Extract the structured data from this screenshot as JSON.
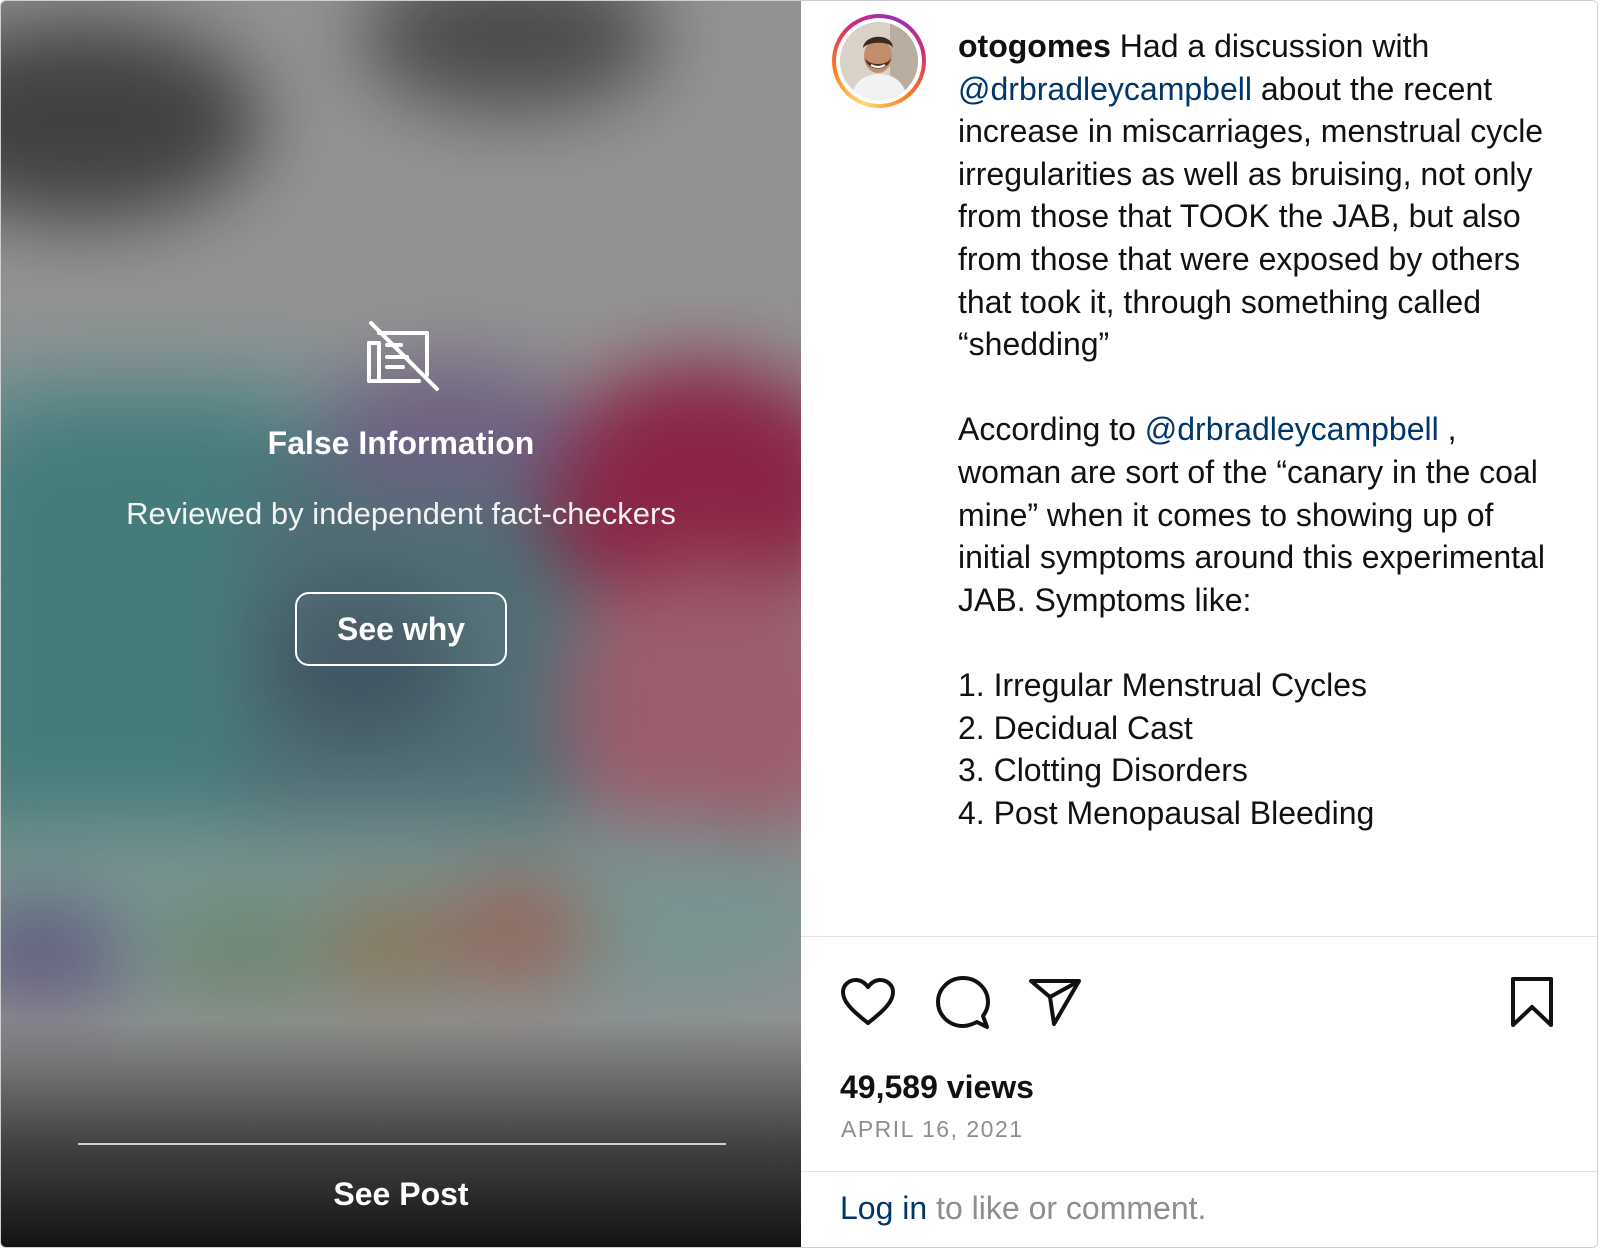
{
  "overlay": {
    "title": "False Information",
    "subtitle": "Reviewed by independent fact-checkers",
    "see_why_label": "See why",
    "see_post_label": "See Post",
    "icon": "false-information-icon"
  },
  "post": {
    "username": "otogomes",
    "caption": {
      "intro": "Had a discussion with",
      "mention1": "@drbradleycampbell",
      "part1": "about the recent increase in miscarriages, menstrual cycle irregularities as well as bruising, not only from those that TOOK the JAB, but also from those that were exposed by others that took it, through something called “shedding”",
      "p2_intro": "According to",
      "mention2": "@drbradleycampbell",
      "p2_rest": ", woman are sort of the “canary in the coal mine” when it comes to showing up of initial symptoms around this experimental JAB. Symptoms like:",
      "list": [
        "1. Irregular Menstrual Cycles",
        "2. Decidual Cast",
        "3. Clotting Disorders",
        "4. Post Menopausal Bleeding"
      ]
    },
    "views": "49,589 views",
    "date": "APRIL 16, 2021",
    "login_label": "Log in",
    "login_suffix": "to like or comment."
  },
  "icons": {
    "like": "heart-icon",
    "comment": "comment-icon",
    "share": "share-icon",
    "save": "bookmark-icon"
  },
  "colors": {
    "link": "#00376b",
    "muted": "#8e8e8e",
    "text": "#111111"
  }
}
